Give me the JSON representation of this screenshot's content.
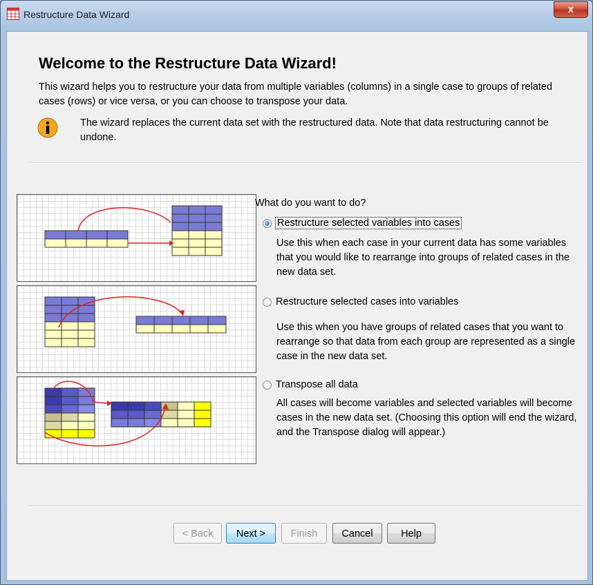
{
  "window": {
    "title": "Restructure Data Wizard",
    "close_label": "x"
  },
  "header": {
    "heading": "Welcome to the Restructure Data Wizard!",
    "intro": "This wizard helps you to restructure your data from multiple variables (columns) in a single case to groups of related cases (rows) or vice versa, or you can choose to transpose your data.",
    "note": "The wizard replaces the current data set with the restructured data.  Note that data restructuring cannot be undone."
  },
  "question": "What do you want to do?",
  "options": [
    {
      "label": "Restructure selected variables into cases",
      "selected": true,
      "description": "Use this when each case in your current data has some variables that you would like to rearrange into groups of related cases in the new data set."
    },
    {
      "label": "Restructure selected cases into variables",
      "selected": false,
      "description": "Use this when you have groups of related cases that you want to rearrange so that data from each group are represented as a single case in the new data set."
    },
    {
      "label": "Transpose all data",
      "selected": false,
      "description": "All cases will become variables and selected variables will become cases in the new data set. (Choosing this option will end the wizard, and the Transpose dialog will appear.)"
    }
  ],
  "buttons": {
    "back": "< Back",
    "next": "Next >",
    "finish": "Finish",
    "cancel": "Cancel",
    "help": "Help"
  },
  "icons": {
    "title": "table-grid-icon",
    "info": "info-icon"
  },
  "colors": {
    "variable_cell": "#7b7bd6",
    "case_cell": "#ffffc0",
    "arrow": "#e02020",
    "transpose_dark": "#3b3ba8",
    "transpose_yellow": "#ffff00"
  }
}
